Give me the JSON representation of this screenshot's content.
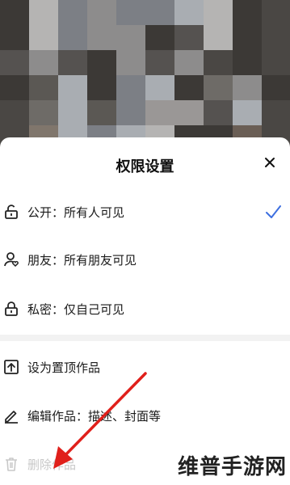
{
  "sheet": {
    "title": "权限设置",
    "close_icon": "close-icon",
    "visibility_options": [
      {
        "icon": "lock-open-icon",
        "label": "公开：所有人可见",
        "selected": true
      },
      {
        "icon": "friends-icon",
        "label": "朋友：所有朋友可见",
        "selected": false
      },
      {
        "icon": "lock-icon",
        "label": "私密：仅自己可见",
        "selected": false
      }
    ],
    "actions": [
      {
        "icon": "pin-top-icon",
        "label": "设为置顶作品"
      },
      {
        "icon": "edit-icon",
        "label": "编辑作品：描述、封面等"
      },
      {
        "icon": "trash-icon",
        "label": "删除作品"
      }
    ],
    "check_color": "#3d6fe0"
  },
  "watermark": "维普手游网",
  "annotation_arrow_color": "#e0201b"
}
